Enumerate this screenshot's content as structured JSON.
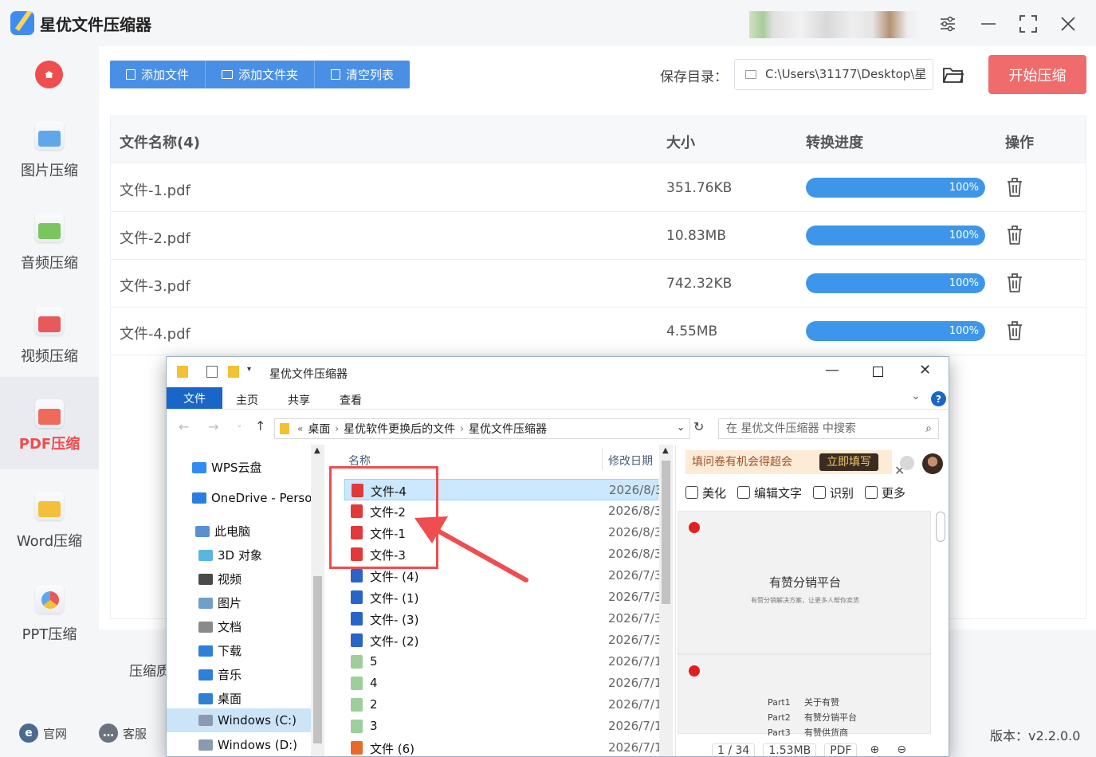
{
  "app": {
    "title": "星优文件压缩器",
    "version": "版本：v2.2.0.0"
  },
  "sidebar": {
    "items": [
      {
        "label": "图片压缩",
        "color": "#5fa7e8"
      },
      {
        "label": "音频压缩",
        "color": "#6cc46a"
      },
      {
        "label": "视频压缩",
        "color": "#e85a5a"
      },
      {
        "label": "PDF压缩",
        "color": "#ef4d4f",
        "active": true
      },
      {
        "label": "Word压缩",
        "color": "#f2c03a"
      },
      {
        "label": "PPT压缩",
        "color": "#f08a3a"
      }
    ]
  },
  "toolbar": {
    "add_file": "添加文件",
    "add_folder": "添加文件夹",
    "clear_list": "清空列表"
  },
  "save": {
    "label": "保存目录：",
    "path": "C:\\Users\\31177\\Desktop\\星"
  },
  "start_button": "开始压缩",
  "table": {
    "headers": {
      "name": "文件名称(4)",
      "size": "大小",
      "progress": "转换进度",
      "action": "操作"
    },
    "rows": [
      {
        "name": "文件-1.pdf",
        "size": "351.76KB",
        "progress": "100%"
      },
      {
        "name": "文件-2.pdf",
        "size": "10.83MB",
        "progress": "100%"
      },
      {
        "name": "文件-3.pdf",
        "size": "742.32KB",
        "progress": "100%"
      },
      {
        "name": "文件-4.pdf",
        "size": "4.55MB",
        "progress": "100%"
      }
    ]
  },
  "bottom": {
    "compress_label": "压缩质"
  },
  "footer": {
    "website": "官网",
    "service": "客服"
  },
  "explorer": {
    "title": "星优文件压缩器",
    "ribbon_tabs": {
      "file": "文件",
      "home": "主页",
      "share": "共享",
      "view": "查看"
    },
    "breadcrumb": [
      "桌面",
      "星优软件更换后的文件",
      "星优文件压缩器"
    ],
    "search_placeholder": "在 星优文件压缩器 中搜索",
    "nav": [
      {
        "label": "WPS云盘",
        "color": "#2f8cf2"
      },
      {
        "label": "OneDrive - Person",
        "color": "#2a7de1"
      },
      {
        "label": "此电脑",
        "color": "#5b8fcf"
      },
      {
        "label": "3D 对象",
        "color": "#58b6e0"
      },
      {
        "label": "视频",
        "color": "#4a4a4a"
      },
      {
        "label": "图片",
        "color": "#6ea0c8"
      },
      {
        "label": "文档",
        "color": "#8a8a8a"
      },
      {
        "label": "下载",
        "color": "#2f7fd6"
      },
      {
        "label": "音乐",
        "color": "#2f7fd6"
      },
      {
        "label": "桌面",
        "color": "#2f7fd6"
      },
      {
        "label": "Windows (C:)",
        "color": "#8a9bb0"
      },
      {
        "label": "Windows (D:)",
        "color": "#8a9bb0"
      }
    ],
    "columns": {
      "name": "名称",
      "date": "修改日期"
    },
    "files": [
      {
        "name": "文件-4",
        "date": "2026/8/3",
        "type": "pdf"
      },
      {
        "name": "文件-2",
        "date": "2026/8/3",
        "type": "pdf"
      },
      {
        "name": "文件-1",
        "date": "2026/8/3",
        "type": "pdf"
      },
      {
        "name": "文件-3",
        "date": "2026/8/3",
        "type": "pdf"
      },
      {
        "name": "文件- (4)",
        "date": "2026/7/3",
        "type": "word"
      },
      {
        "name": "文件- (1)",
        "date": "2026/7/3",
        "type": "word"
      },
      {
        "name": "文件- (3)",
        "date": "2026/7/3",
        "type": "word"
      },
      {
        "name": "文件- (2)",
        "date": "2026/7/3",
        "type": "word"
      },
      {
        "name": "5",
        "date": "2026/7/1",
        "type": "generic"
      },
      {
        "name": "4",
        "date": "2026/7/1",
        "type": "generic"
      },
      {
        "name": "2",
        "date": "2026/7/1",
        "type": "generic"
      },
      {
        "name": "3",
        "date": "2026/7/1",
        "type": "generic"
      },
      {
        "name": "文件 (6)",
        "date": "2026/7/1",
        "type": "ppt"
      }
    ],
    "preview": {
      "promo_text": "填问卷有机会得超会",
      "promo_button": "立即填写",
      "tools": [
        "美化",
        "编辑文字",
        "识别",
        "更多"
      ],
      "page1_title": "有赞分销平台",
      "page1_subtitle": "有赞分销解决方案，让更多人帮你卖货",
      "page2_lines": [
        [
          "Part1",
          "关于有赞"
        ],
        [
          "Part2",
          "有赞分销平台"
        ],
        [
          "Part3",
          "有赞供货商"
        ]
      ],
      "status": [
        "1 / 34",
        "1.53MB",
        "PDF"
      ]
    }
  }
}
